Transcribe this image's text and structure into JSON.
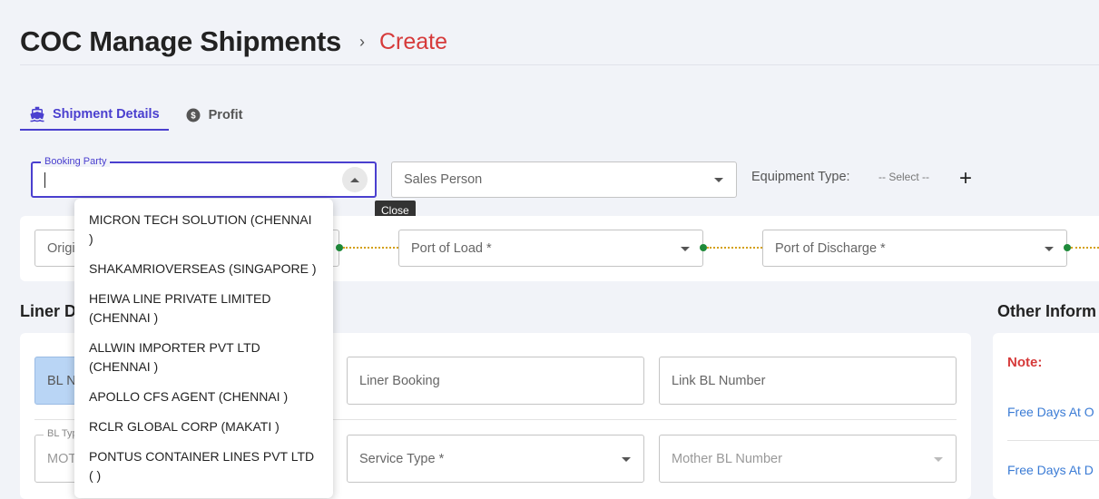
{
  "header": {
    "title": "COC Manage Shipments",
    "separator": "›",
    "crumb": "Create"
  },
  "tabs": [
    {
      "label": "Shipment Details",
      "icon": "ship-icon",
      "active": true
    },
    {
      "label": "Profit",
      "icon": "dollar-circle-icon",
      "active": false
    }
  ],
  "form": {
    "booking_party_label": "Booking Party",
    "booking_party_value": "",
    "sales_person_placeholder": "Sales Person",
    "equipment_type_label": "Equipment Type:",
    "equipment_type_select": "-- Select --",
    "add_symbol": "+"
  },
  "tooltip": "Close",
  "route": {
    "origin_placeholder": "Origi",
    "port_of_load_placeholder": "Port of Load *",
    "port_of_discharge_placeholder": "Port of Discharge *"
  },
  "sections": {
    "liner": "Liner D",
    "other": "Other Inform"
  },
  "liner": {
    "bl_number_placeholder": "BL N",
    "liner_booking_placeholder": "Liner Booking",
    "link_bl_placeholder": "Link BL Number",
    "bl_type_label": "BL Typ",
    "bl_type_value": "MOT",
    "service_type_placeholder": "Service Type *",
    "mother_bl_placeholder": "Mother BL Number"
  },
  "other": {
    "note": "Note:",
    "free_days_1": "Free Days At O",
    "free_days_2": "Free Days At D"
  },
  "dropdown_options": [
    "MICRON TECH SOLUTION (CHENNAI )",
    "SHAKAMRIOVERSEAS (SINGAPORE )",
    "HEIWA LINE PRIVATE LIMITED (CHENNAI )",
    "ALLWIN IMPORTER PVT LTD (CHENNAI )",
    "APOLLO CFS AGENT (CHENNAI )",
    "RCLR GLOBAL CORP (MAKATI )",
    "PONTUS CONTAINER LINES PVT LTD ( )"
  ],
  "colors": {
    "accent": "#4a3fcf",
    "crumb": "#d63a3a",
    "route_dot": "#1e8a3a",
    "route_line": "#d4a010",
    "link": "#3a7bd5"
  }
}
